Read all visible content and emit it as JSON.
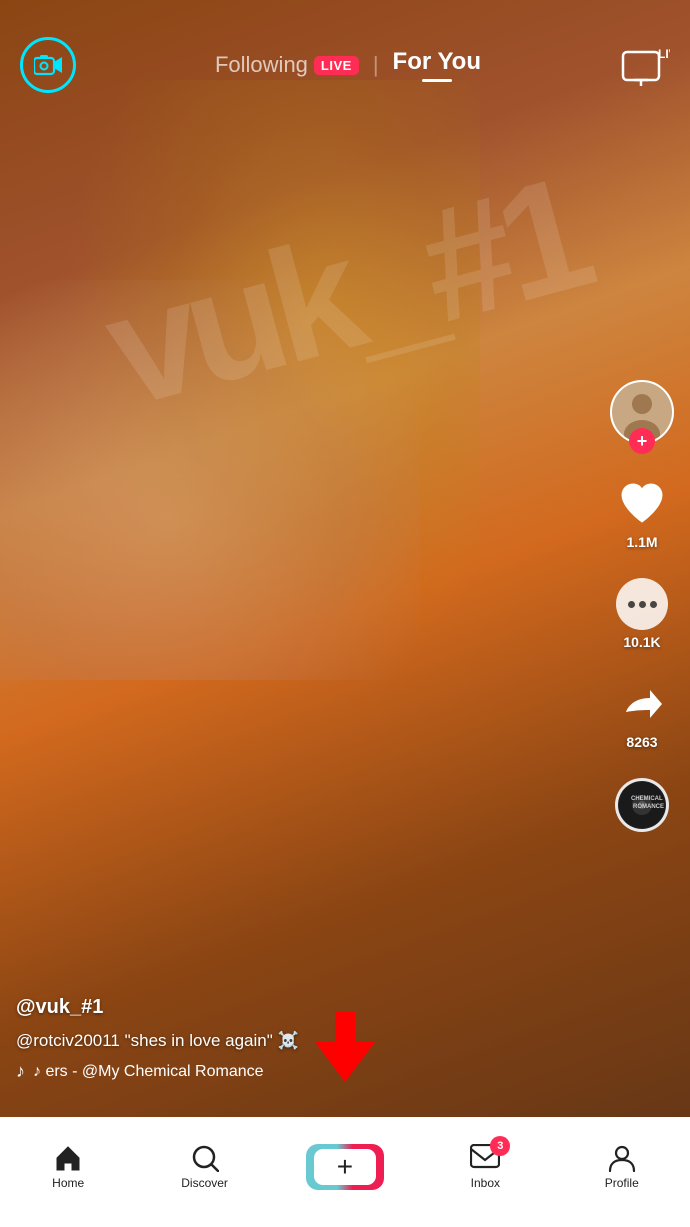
{
  "video": {
    "watermark": "vuk_#1"
  },
  "header": {
    "following_label": "Following",
    "live_badge": "LIVE",
    "for_you_label": "For You",
    "live_tv_label": "LIVE"
  },
  "actions": {
    "likes": "1.1M",
    "comments": "10.1K",
    "shares": "8263"
  },
  "post": {
    "username": "@vuk_#1",
    "caption": "@rotciv20011 \"shes in love again\" ☠️",
    "music": "♪  ers - @My Chemical Romance",
    "music_note": "♪"
  },
  "nav": {
    "home_label": "Home",
    "discover_label": "Discover",
    "inbox_label": "Inbox",
    "inbox_badge": "3",
    "profile_label": "Profile"
  }
}
